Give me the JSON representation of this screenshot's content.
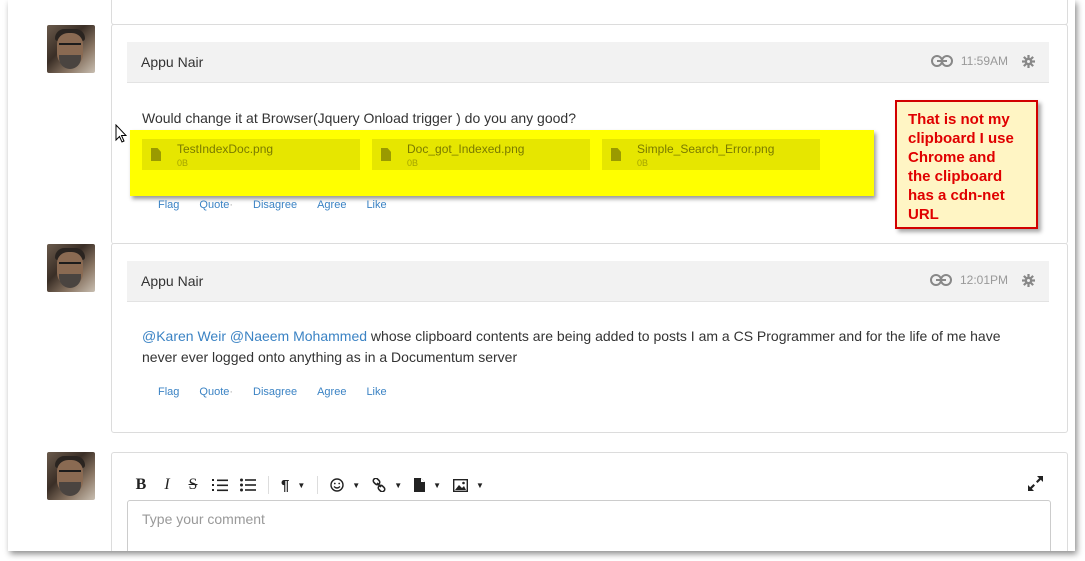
{
  "posts": [
    {
      "author": "Appu Nair",
      "time": "11:59AM",
      "text": "Would change it at Browser(Jquery Onload trigger ) do you any good?",
      "attachments": [
        {
          "name": "TestIndexDoc.png",
          "size": "0B"
        },
        {
          "name": "Doc_got_Indexed.png",
          "size": "0B"
        },
        {
          "name": "Simple_Search_Error.png",
          "size": "0B"
        }
      ],
      "actions": {
        "flag": "Flag",
        "quote": "Quote",
        "dot": "·",
        "disagree": "Disagree",
        "agree": "Agree",
        "like": "Like"
      }
    },
    {
      "author": "Appu Nair",
      "time": "12:01PM",
      "mention1": "@Karen Weir",
      "mention2": "@Naeem Mohammed",
      "text": " whose clipboard contents are being added to posts I am a CS Programmer and for the life of me have never ever logged onto anything as in a Documentum server",
      "actions": {
        "flag": "Flag",
        "quote": "Quote",
        "dot": "·",
        "disagree": "Disagree",
        "agree": "Agree",
        "like": "Like"
      }
    }
  ],
  "callout": {
    "line1": "That is not my",
    "line2": "clipboard I use",
    "line3": "Chrome and",
    "line4": "the clipboard",
    "line5": "has a cdn-net",
    "line6": "URL"
  },
  "editor": {
    "bold": "B",
    "italic": "I",
    "strike": "S",
    "paragraph": "¶",
    "placeholder": "Type your comment"
  },
  "colors": {
    "highlight": "#ffff00",
    "callout_border": "#d20000",
    "callout_text": "#e00000",
    "link": "#3b83c4"
  }
}
